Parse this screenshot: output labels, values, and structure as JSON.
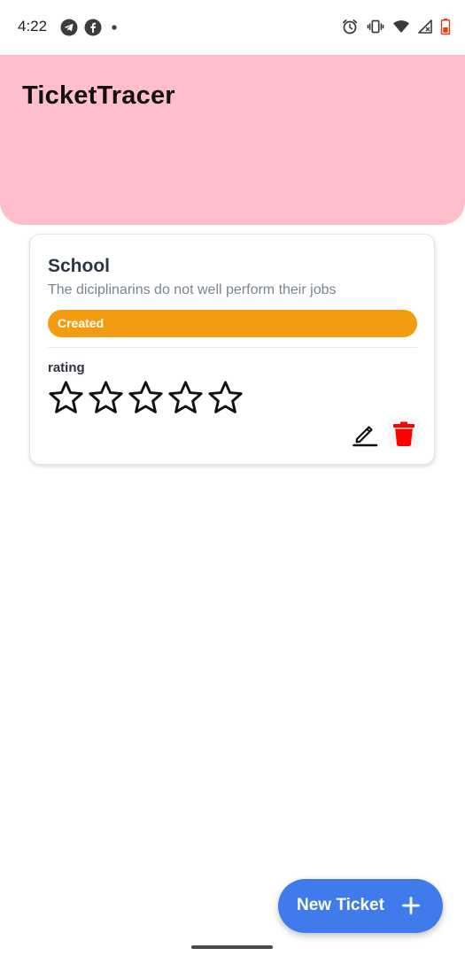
{
  "status_bar": {
    "time": "4:22",
    "left_icons": [
      "telegram-icon",
      "facebook-icon",
      "notification-dot-icon"
    ],
    "right_icons": [
      "alarm-icon",
      "vibrate-icon",
      "wifi-icon",
      "signal-icon",
      "battery-icon"
    ]
  },
  "header": {
    "title": "TicketTracer",
    "background_color": "#ffbfca"
  },
  "tickets": [
    {
      "title": "School",
      "description": "The diciplinarins do not well perform their jobs",
      "status": "Created",
      "status_color": "#f39c12",
      "rating_label": "rating",
      "rating": 0,
      "rating_max": 5,
      "actions": [
        "edit-icon",
        "trash-icon"
      ]
    }
  ],
  "fab": {
    "label": "New Ticket",
    "icon": "plus-icon",
    "color": "#3f7bea"
  },
  "colors": {
    "delete": "#ff0000",
    "accent": "#3f7bea"
  }
}
